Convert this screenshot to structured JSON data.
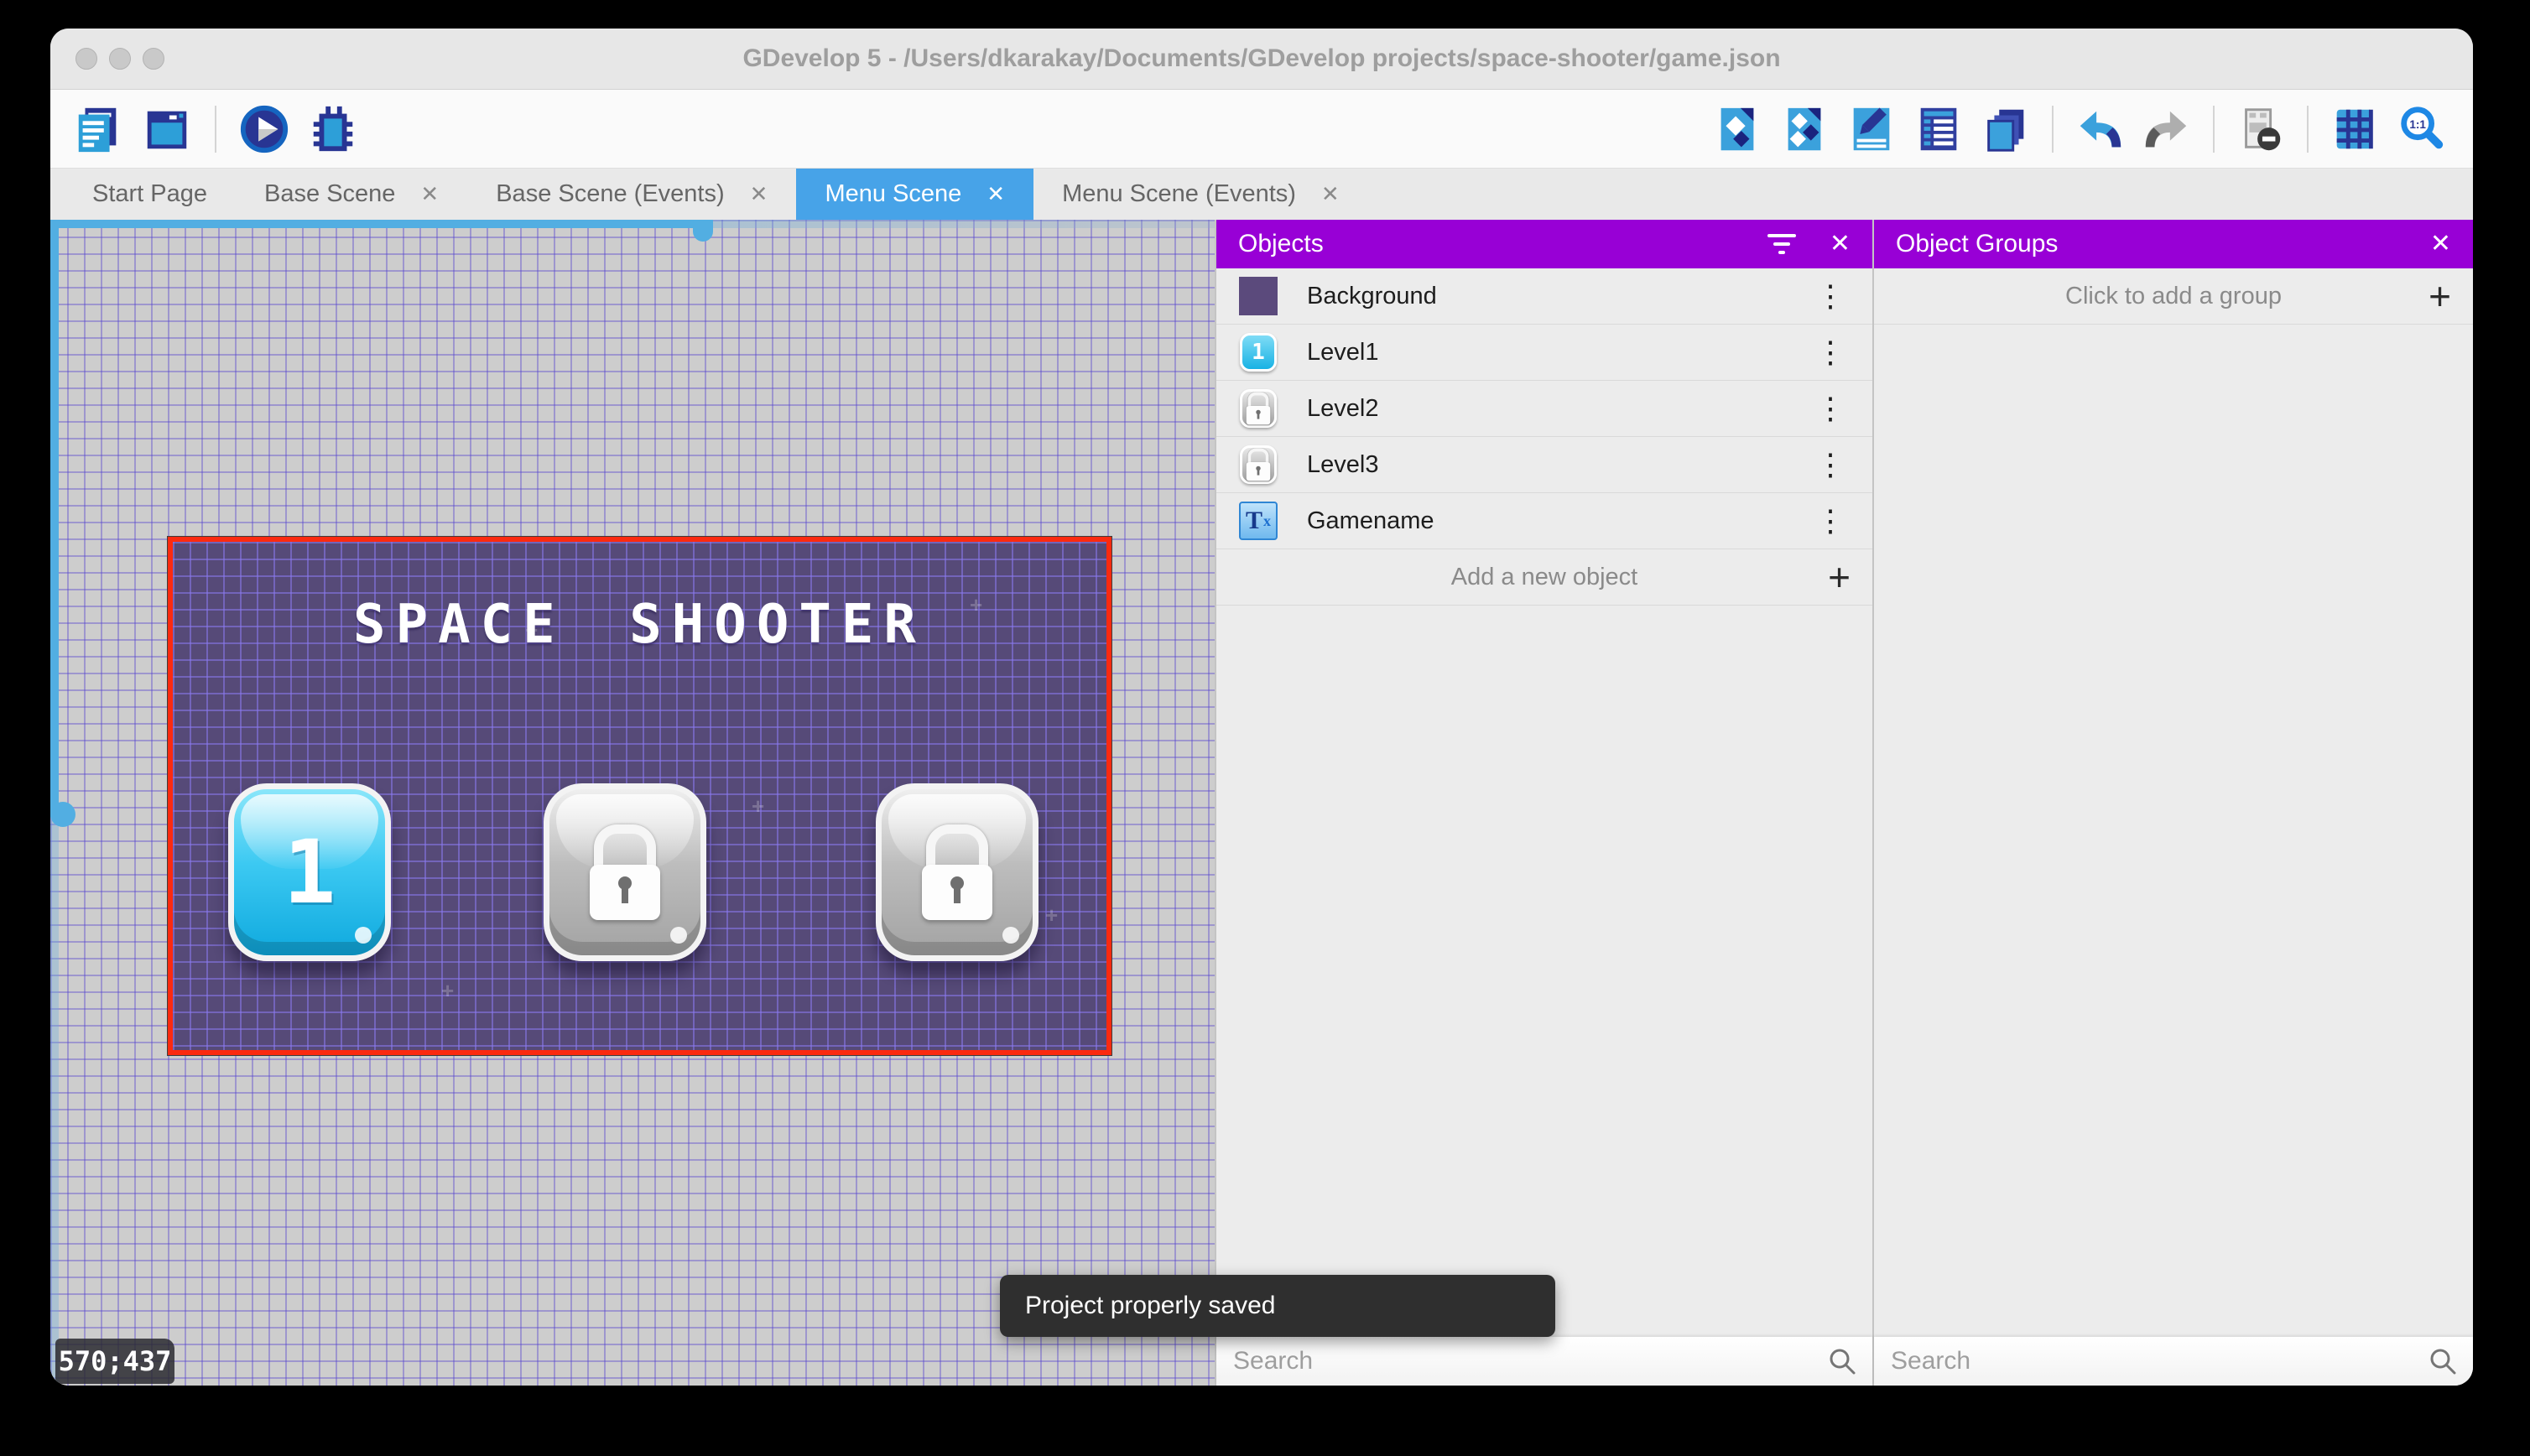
{
  "window": {
    "title": "GDevelop 5 - /Users/dkarakay/Documents/GDevelop projects/space-shooter/game.json"
  },
  "toolbar": {
    "left_icons": [
      "project-manager",
      "start-page-window",
      "preview-play",
      "debugger-bug"
    ],
    "right_icons": [
      "objects-editor",
      "object-groups-editor",
      "properties-pencil",
      "instances-list",
      "layers-editor",
      "undo",
      "redo",
      "filmstrip-mask",
      "grid-toggle",
      "zoom-one-to-one"
    ]
  },
  "tabs": [
    {
      "label": "Start Page",
      "active": false,
      "closable": false
    },
    {
      "label": "Base Scene",
      "active": false,
      "closable": true
    },
    {
      "label": "Base Scene (Events)",
      "active": false,
      "closable": true
    },
    {
      "label": "Menu Scene",
      "active": true,
      "closable": true
    },
    {
      "label": "Menu Scene (Events)",
      "active": false,
      "closable": true
    }
  ],
  "canvas": {
    "coordinates": "570;437",
    "scene": {
      "title": "SPACE SHOOTER",
      "buttons": [
        {
          "label": "1",
          "state": "unlocked"
        },
        {
          "label": "",
          "state": "locked"
        },
        {
          "label": "",
          "state": "locked"
        }
      ]
    }
  },
  "objects_panel": {
    "title": "Objects",
    "items": [
      {
        "name": "Background",
        "icon": "background-thumbnail"
      },
      {
        "name": "Level1",
        "icon": "level1-button-thumbnail"
      },
      {
        "name": "Level2",
        "icon": "locked-button-thumbnail"
      },
      {
        "name": "Level3",
        "icon": "locked-button-thumbnail"
      },
      {
        "name": "Gamename",
        "icon": "text-object-thumbnail"
      }
    ],
    "add_label": "Add a new object",
    "search_placeholder": "Search"
  },
  "groups_panel": {
    "title": "Object Groups",
    "add_label": "Click to add a group",
    "search_placeholder": "Search"
  },
  "toast": {
    "message": "Project properly saved"
  },
  "glyphs": {
    "close": "✕",
    "plus": "+",
    "kebab": "⋮"
  },
  "colors": {
    "panel_header_purple": "#9800d6",
    "active_tab_blue": "#47a3e8",
    "scene_border_red": "#fb2a10",
    "scrollbar_blue": "#52aee2",
    "scene_background_purple": "#564a78"
  }
}
